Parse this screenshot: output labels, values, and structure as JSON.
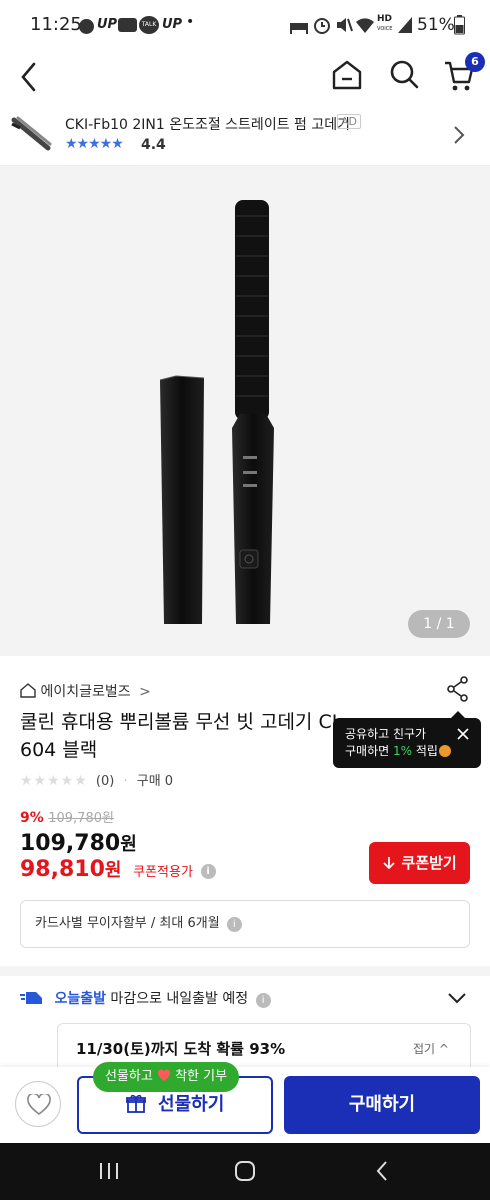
{
  "status": {
    "time": "11:25",
    "up1": "UP",
    "talk": "TALK",
    "up2": "UP",
    "dot": "•",
    "hd": "HD",
    "voice": "VOICE",
    "battery": "51%"
  },
  "header": {
    "cart_count": "6"
  },
  "ad": {
    "title": "CKI-Fb10 2IN1 온도조절 스트레이트 펌 고데기",
    "badge": "AD",
    "rating": "4.4"
  },
  "gallery": {
    "pager": "1 / 1"
  },
  "product": {
    "brand": "에이치글로벌즈",
    "brand_chevron": ">",
    "title": "쿨린 휴대용 뿌리볼륨 무선 빗 고데기 CL-604 블랙",
    "review_count": "(0)",
    "sep": "·",
    "purchase": "구매 0",
    "discount_rate": "9%",
    "original_price": "109,780원",
    "price_num": "109,780",
    "price_unit": "원",
    "coupon_price_num": "98,810",
    "coupon_price_unit": "원",
    "coupon_label": "쿠폰적용가",
    "coupon_button": "쿠폰받기",
    "card_info": "카드사별 무이자할부 / 최대 6개월"
  },
  "share_tip": {
    "line1": "공유하고 친구가",
    "line2a": "구매하면 ",
    "line2b": "1%",
    "line2c": " 적립"
  },
  "shipping": {
    "label_hl": "오늘출발",
    "label_rest": " 마감으로 내일출발 예정",
    "arrival": "11/30(토)까지 도착 확률 93%",
    "fold": "접기"
  },
  "actions": {
    "gift_bubble_a": "선물하고",
    "gift_bubble_b": "착한 기부",
    "gift": "선물하기",
    "buy": "구매하기"
  },
  "colors": {
    "primary": "#1a2fb6",
    "red": "#e4151b",
    "green": "#2faa2f",
    "star": "#3d6fe0"
  }
}
